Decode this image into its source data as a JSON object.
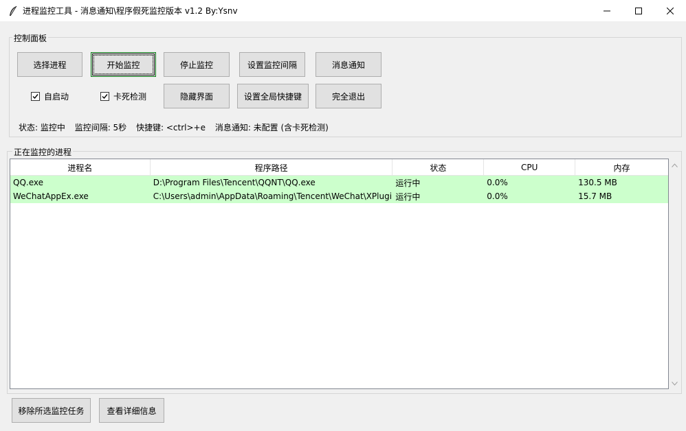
{
  "window": {
    "title": "进程监控工具 - 消息通知\\程序假死监控版本 v1.2    By:Ysnv",
    "icon": "feather-icon",
    "controls": {
      "minimize": "minimize-icon",
      "maximize": "maximize-icon",
      "close": "close-icon"
    }
  },
  "control_panel": {
    "label": "控制面板",
    "buttons_row1": [
      "选择进程",
      "开始监控",
      "停止监控",
      "设置监控间隔",
      "消息通知"
    ],
    "buttons_row2": [
      "隐藏界面",
      "设置全局快捷键",
      "完全退出"
    ],
    "checkboxes": [
      {
        "label": "自启动",
        "checked": true
      },
      {
        "label": "卡死检测",
        "checked": true
      }
    ],
    "status": {
      "state": "状态: 监控中",
      "interval": "监控间隔: 5秒",
      "hotkey": "快捷键: <ctrl>+e",
      "notify": "消息通知: 未配置 (含卡死检测)"
    }
  },
  "process_list": {
    "label": "正在监控的进程",
    "columns": [
      "进程名",
      "程序路径",
      "状态",
      "CPU",
      "内存"
    ],
    "rows": [
      {
        "name": "QQ.exe",
        "path": "D:\\Program Files\\Tencent\\QQNT\\QQ.exe",
        "status": "运行中",
        "cpu": "0.0%",
        "mem": "130.5 MB"
      },
      {
        "name": "WeChatAppEx.exe",
        "path": "C:\\Users\\admin\\AppData\\Roaming\\Tencent\\WeChat\\XPlugi",
        "status": "运行中",
        "cpu": "0.0%",
        "mem": "15.7 MB"
      }
    ],
    "row_color": "#ccffcc"
  },
  "bottom_buttons": [
    "移除所选监控任务",
    "查看详细信息"
  ]
}
